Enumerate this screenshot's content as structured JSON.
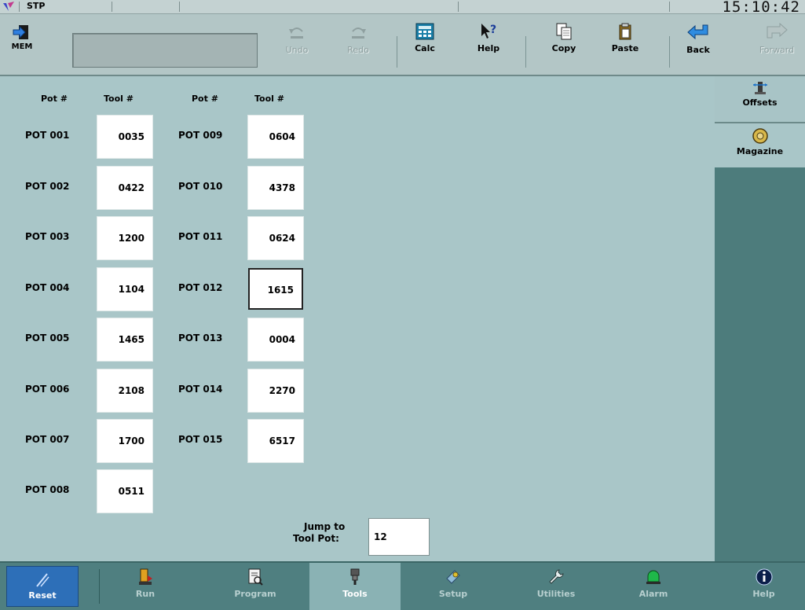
{
  "status": {
    "mode": "STP",
    "clock": "15:10:42"
  },
  "toolbar": {
    "mem_label": "MEM",
    "undo_label": "Undo",
    "redo_label": "Redo",
    "calc_label": "Calc",
    "help_label": "Help",
    "copy_label": "Copy",
    "paste_label": "Paste",
    "back_label": "Back",
    "forward_label": "Forward"
  },
  "table": {
    "pot_header": "Pot #",
    "tool_header": "Tool #",
    "left_column": [
      {
        "pot": "POT 001",
        "tool": "0035"
      },
      {
        "pot": "POT 002",
        "tool": "0422"
      },
      {
        "pot": "POT 003",
        "tool": "1200"
      },
      {
        "pot": "POT 004",
        "tool": "1104"
      },
      {
        "pot": "POT 005",
        "tool": "1465"
      },
      {
        "pot": "POT 006",
        "tool": "2108"
      },
      {
        "pot": "POT 007",
        "tool": "1700"
      },
      {
        "pot": "POT 008",
        "tool": "0511"
      }
    ],
    "right_column": [
      {
        "pot": "POT 009",
        "tool": "0604"
      },
      {
        "pot": "POT 010",
        "tool": "4378"
      },
      {
        "pot": "POT 011",
        "tool": "0624"
      },
      {
        "pot": "POT 012",
        "tool": "1615"
      },
      {
        "pot": "POT 013",
        "tool": "0004"
      },
      {
        "pot": "POT 014",
        "tool": "2270"
      },
      {
        "pot": "POT 015",
        "tool": "6517"
      }
    ]
  },
  "jump": {
    "label_line1": "Jump to",
    "label_line2": "Tool Pot:",
    "value": "12"
  },
  "side": {
    "offsets_label": "Offsets",
    "magazine_label": "Magazine"
  },
  "nav": {
    "reset_label": "Reset",
    "run_label": "Run",
    "program_label": "Program",
    "tools_label": "Tools",
    "setup_label": "Setup",
    "utilities_label": "Utilities",
    "alarm_label": "Alarm",
    "help_label": "Help"
  },
  "colors": {
    "panel_bg": "#a9c6c8",
    "nav_bg": "#4f7f80",
    "reset_blue": "#2d6fb8",
    "alarm_green": "#1fb84a"
  }
}
